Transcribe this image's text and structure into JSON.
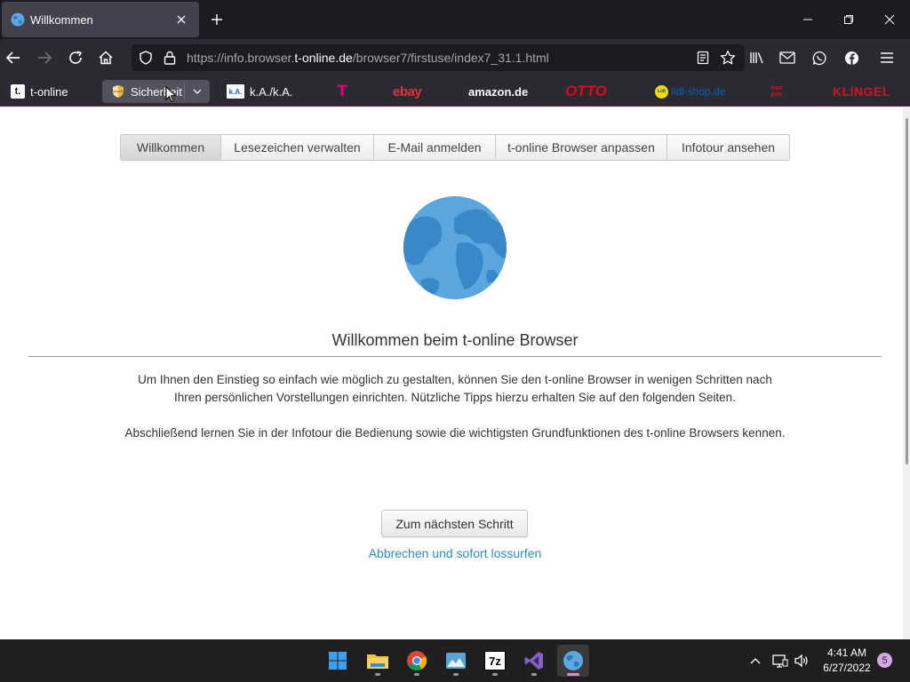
{
  "browser": {
    "tab_title": "Willkommen",
    "url_prefix": "https://info.browser.",
    "url_domain": "t-online.de",
    "url_path": "/browser7/firstuse/index7_31.1.html"
  },
  "bookmarks": {
    "tonline_label": "t-online",
    "tonline_icon_text": "t.",
    "sicherheit_label": "Sicherheit",
    "ka_label": "k.A./k.A.",
    "ka_icon_text": "k.A.",
    "telekom_text": "T",
    "ebay": "ebay",
    "amazon": "amazon.de",
    "otto": "OTTO",
    "lidl_label": "lidl-shop.de",
    "lidl_icon_text": "Lidl",
    "bonprix": "bon prix",
    "klingel": "KLINGEL"
  },
  "page": {
    "tabs": [
      "Willkommen",
      "Lesezeichen verwalten",
      "E-Mail anmelden",
      "t-online Browser anpassen",
      "Infotour ansehen"
    ],
    "title": "Willkommen beim t-online Browser",
    "para1_line1": "Um Ihnen den Einstieg so einfach wie möglich zu gestalten, können Sie den t-online Browser in wenigen Schritten nach",
    "para1_line2": "Ihren persönlichen Vorstellungen einrichten. Nützliche Tipps hierzu erhalten Sie auf den folgenden Seiten.",
    "para2": "Abschließend lernen Sie in der Infotour die Bedienung sowie die wichtigsten Grundfunktionen des t-online Browsers kennen.",
    "next_button": "Zum nächsten Schritt",
    "cancel_link": "Abbrechen und sofort lossurfen"
  },
  "taskbar": {
    "sevenzip_text": "7z",
    "time": "4:41 AM",
    "date": "6/27/2022",
    "notification_count": "5"
  },
  "colors": {
    "link": "#2a8ec0",
    "tab_bg": "#42414d",
    "toolbar_bg": "#2b2a33",
    "taskbar_bg": "#1f1f1f"
  }
}
